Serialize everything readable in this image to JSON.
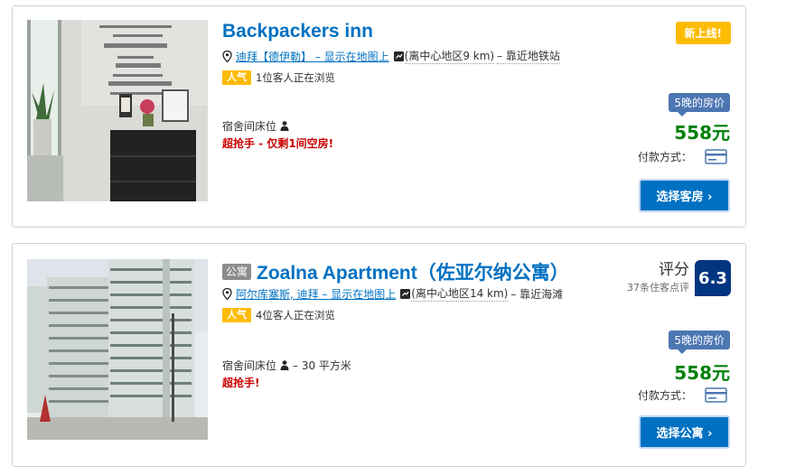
{
  "listings": [
    {
      "name": "Backpackers inn",
      "badge": "新上线!",
      "location_link": "迪拜【德伊勒】 – 显示在地图上",
      "distance": "(离中心地区9 km)",
      "nearby": "– 靠近地铁站",
      "popularity_badge": "人气",
      "viewers": "1位客人正在浏览",
      "room_type": "宿舍间床位",
      "deal": "超抢手 - 仅剩1间空房!",
      "nights_label": "5晚的房价",
      "price": "558元",
      "payment_label": "付款方式：",
      "cta": "选择客房 ›",
      "icons": [
        "pin-icon",
        "train-icon",
        "person-icon",
        "credit-card-icon"
      ]
    },
    {
      "type_badge": "公寓",
      "name": "Zoalna Apartment（佐亚尔纳公寓）",
      "location_link": "阿尔库塞斯, 迪拜 – 显示在地图上",
      "distance": "(离中心地区14 km)",
      "nearby": "– 靠近海滩",
      "popularity_badge": "人气",
      "viewers": "4位客人正在浏览",
      "room_type": "宿舍间床位",
      "room_size": "– 30 平方米",
      "deal": "超抢手!",
      "score_label": "评分",
      "reviews": "37条住客点评",
      "score": "6.3",
      "nights_label": "5晚的房价",
      "price": "558元",
      "payment_label": "付款方式：",
      "cta": "选择公寓 ›",
      "icons": [
        "pin-icon",
        "train-icon",
        "person-icon",
        "credit-card-icon"
      ]
    }
  ],
  "colors": {
    "link": "#0071c2",
    "price": "#008009",
    "deal": "#cc0000",
    "badge": "#febb02",
    "score": "#003580"
  }
}
